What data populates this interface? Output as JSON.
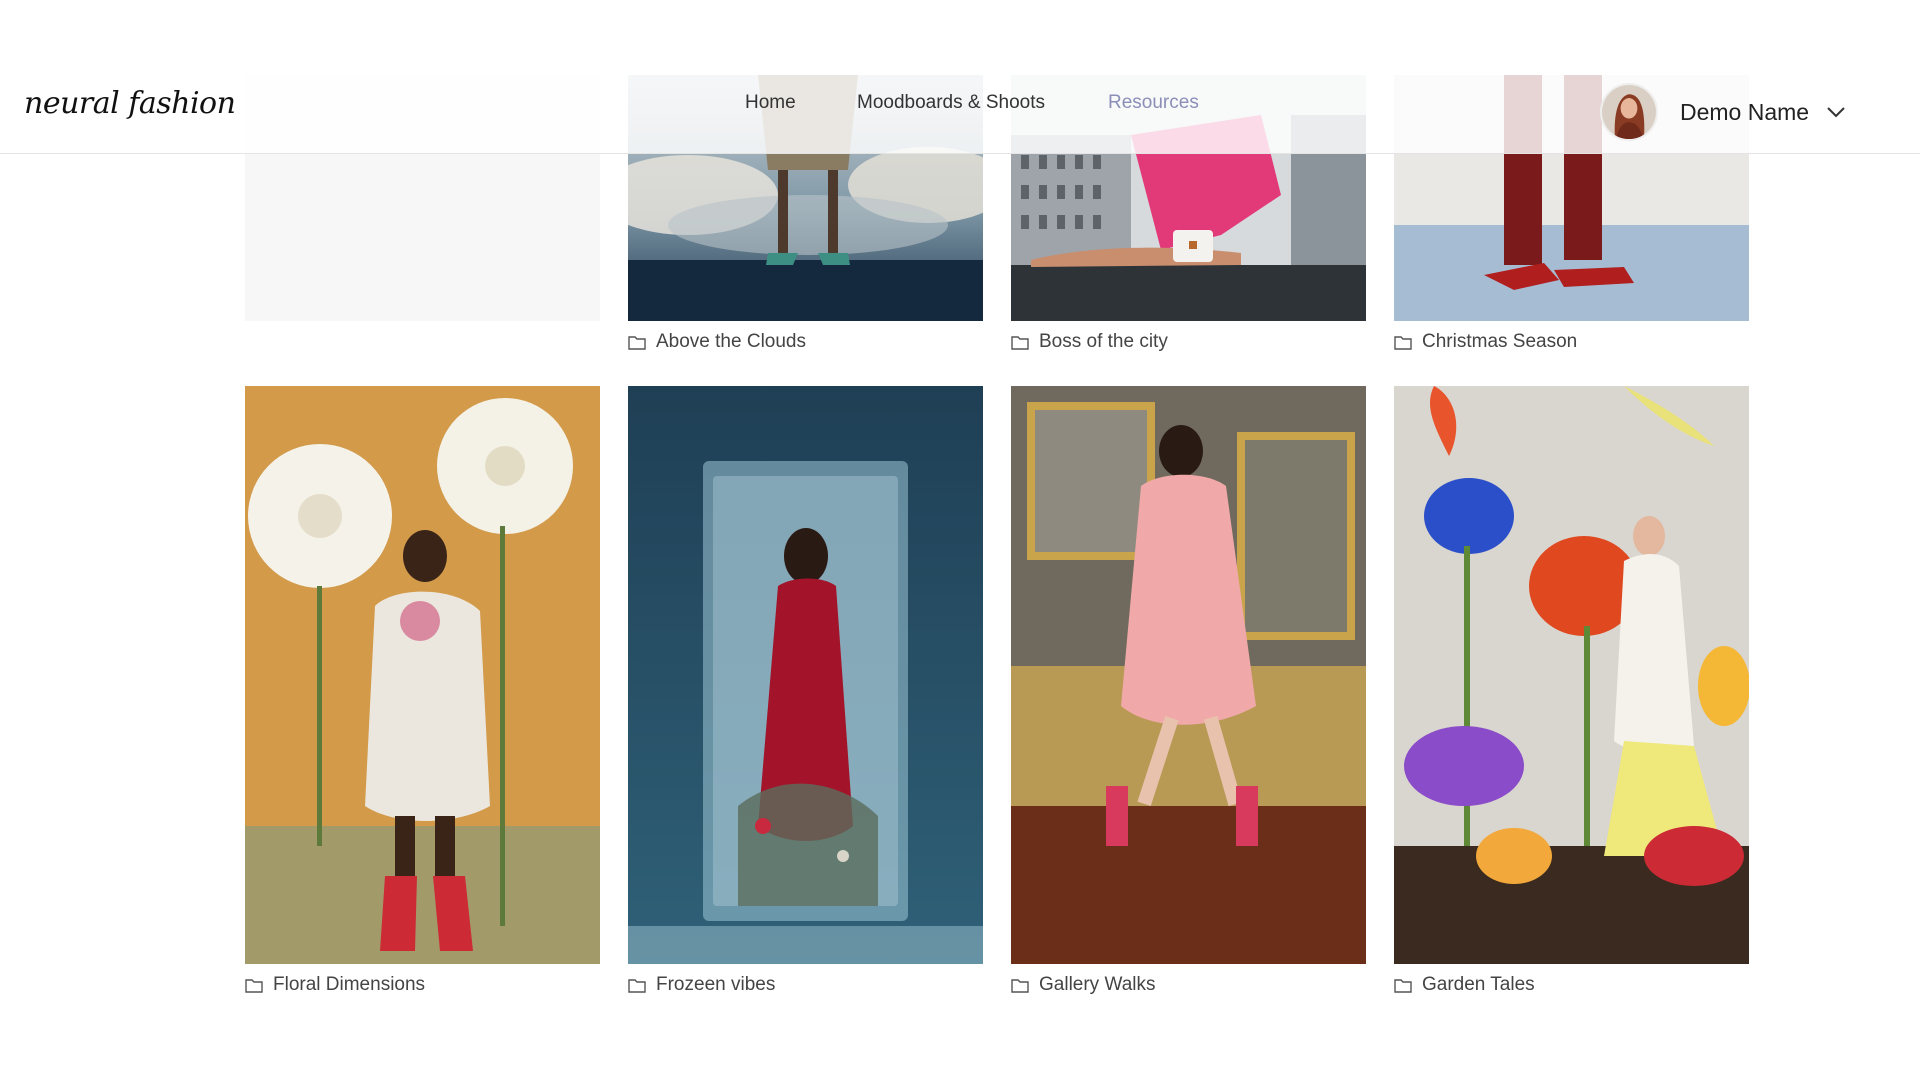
{
  "brand": {
    "logo_text": "neural fashion"
  },
  "nav": {
    "items": [
      {
        "label": "Home",
        "active": false
      },
      {
        "label": "Moodboards & Shoots",
        "active": false
      },
      {
        "label": "Resources",
        "active": true
      }
    ],
    "active_color": "#8b8fb8"
  },
  "user": {
    "name": "Demo Name",
    "avatar_icon": "user-avatar",
    "menu_icon": "chevron-down-icon"
  },
  "collections": [
    {
      "title": "",
      "icon": "folder-icon",
      "image": "placeholder"
    },
    {
      "title": "Above the Clouds",
      "icon": "folder-icon",
      "image": "legs-above-clouds"
    },
    {
      "title": "Boss of the city",
      "icon": "folder-icon",
      "image": "pink-suit-rooftop"
    },
    {
      "title": "Christmas Season",
      "icon": "folder-icon",
      "image": "red-trousers-ribbon-heels"
    },
    {
      "title": "Floral Dimensions",
      "icon": "folder-icon",
      "image": "model-with-giant-flowers"
    },
    {
      "title": "Frozeen vibes",
      "icon": "folder-icon",
      "image": "red-dress-in-ice-block"
    },
    {
      "title": "Gallery Walks",
      "icon": "folder-icon",
      "image": "pink-dress-in-gallery"
    },
    {
      "title": "Garden Tales",
      "icon": "folder-icon",
      "image": "model-among-tulips"
    }
  ],
  "colors": {
    "accent": "#8b8fb8",
    "text": "#2b2b2b",
    "caption": "#444444",
    "divider": "#e4e4e4"
  }
}
